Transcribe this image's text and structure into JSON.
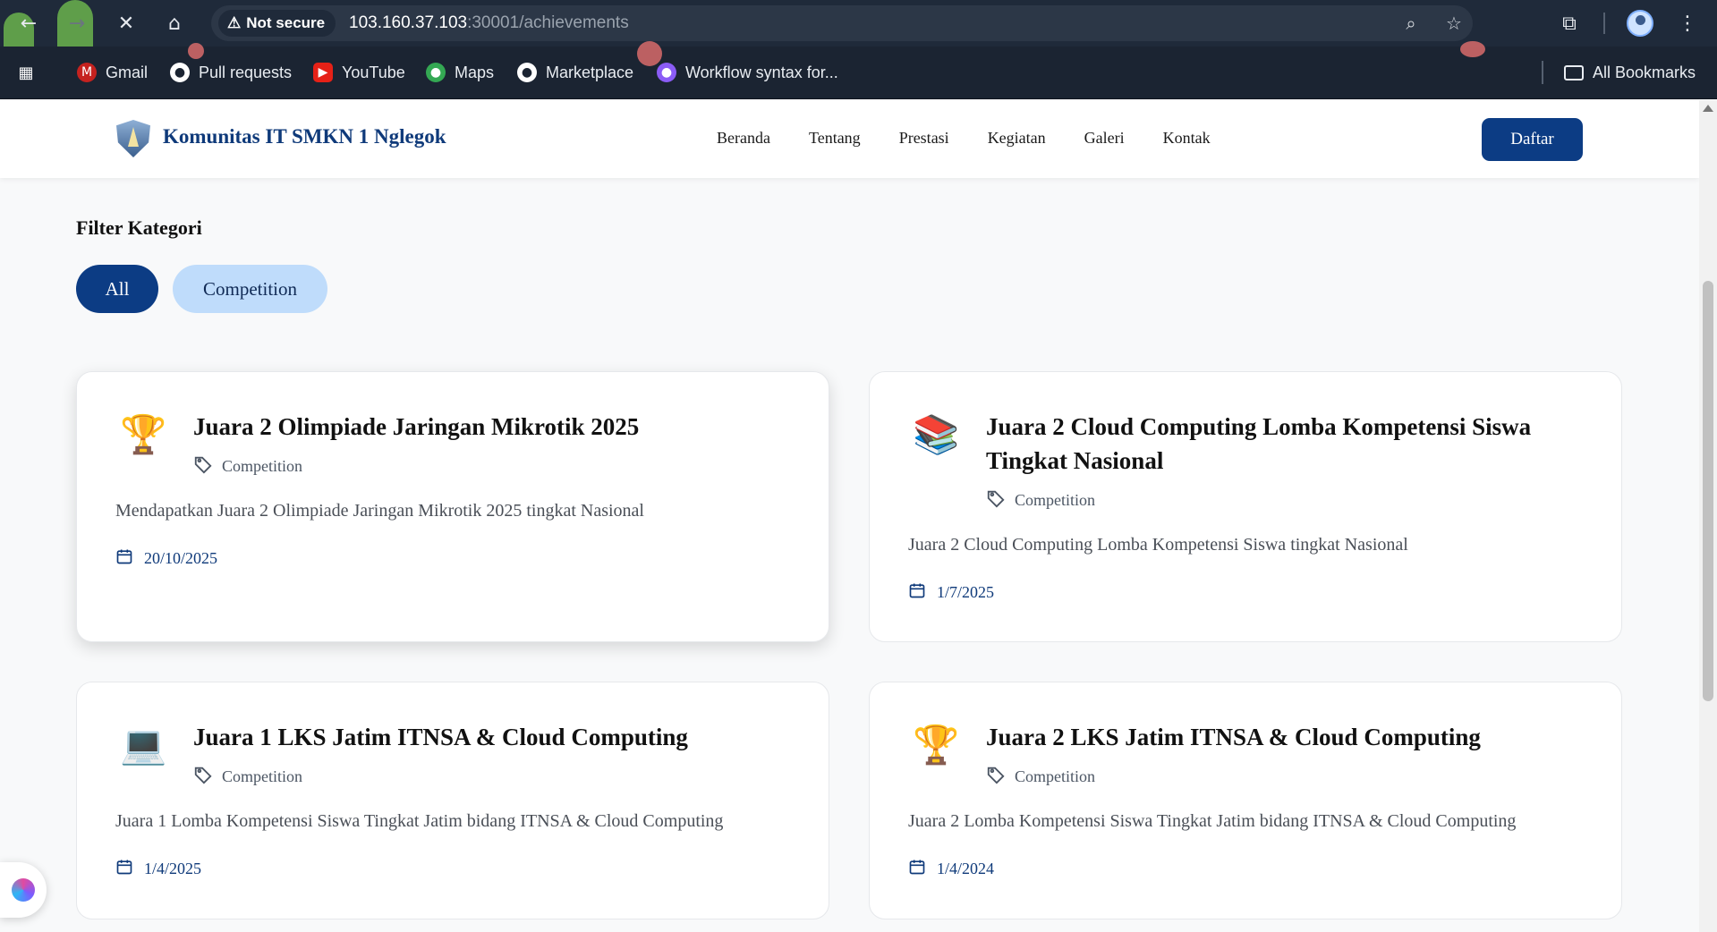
{
  "browser": {
    "security_label": "Not secure",
    "url_host": "103.160.37.103",
    "url_path": ":30001/achievements",
    "bookmarks": [
      {
        "label": "Gmail",
        "icon": "gmail-icon"
      },
      {
        "label": "Pull requests",
        "icon": "github-icon"
      },
      {
        "label": "YouTube",
        "icon": "youtube-icon"
      },
      {
        "label": "Maps",
        "icon": "maps-icon"
      },
      {
        "label": "Marketplace",
        "icon": "github-icon"
      },
      {
        "label": "Workflow syntax for...",
        "icon": "github-icon"
      }
    ],
    "all_bookmarks": "All Bookmarks"
  },
  "header": {
    "brand": "Komunitas IT SMKN 1 Nglegok",
    "nav": [
      "Beranda",
      "Tentang",
      "Prestasi",
      "Kegiatan",
      "Galeri",
      "Kontak"
    ],
    "cta": "Daftar"
  },
  "filter": {
    "title": "Filter Kategori",
    "chips": [
      {
        "label": "All",
        "active": true
      },
      {
        "label": "Competition",
        "active": false
      }
    ]
  },
  "achievements": [
    {
      "icon": "trophy-icon",
      "glyph": "🏆",
      "title": "Juara 2 Olimpiade Jaringan Mikrotik 2025",
      "category": "Competition",
      "description": "Mendapatkan Juara 2 Olimpiade Jaringan Mikrotik 2025 tingkat Nasional",
      "date": "20/10/2025"
    },
    {
      "icon": "books-icon",
      "glyph": "📚",
      "title": "Juara 2 Cloud Computing Lomba Kompetensi Siswa Tingkat Nasional",
      "category": "Competition",
      "description": "Juara 2 Cloud Computing Lomba Kompetensi Siswa tingkat Nasional",
      "date": "1/7/2025"
    },
    {
      "icon": "laptop-icon",
      "glyph": "💻",
      "title": "Juara 1 LKS Jatim ITNSA & Cloud Computing",
      "category": "Competition",
      "description": "Juara 1 Lomba Kompetensi Siswa Tingkat Jatim bidang ITNSA & Cloud Computing",
      "date": "1/4/2025"
    },
    {
      "icon": "trophy-icon",
      "glyph": "🏆",
      "title": "Juara 2 LKS Jatim ITNSA & Cloud Computing",
      "category": "Competition",
      "description": "Juara 2 Lomba Kompetensi Siswa Tingkat Jatim bidang ITNSA & Cloud Computing",
      "date": "1/4/2024"
    }
  ],
  "colors": {
    "primary": "#0c3c84",
    "chip_inactive": "#bfdcfb",
    "page_bg": "#f8f9fa"
  }
}
